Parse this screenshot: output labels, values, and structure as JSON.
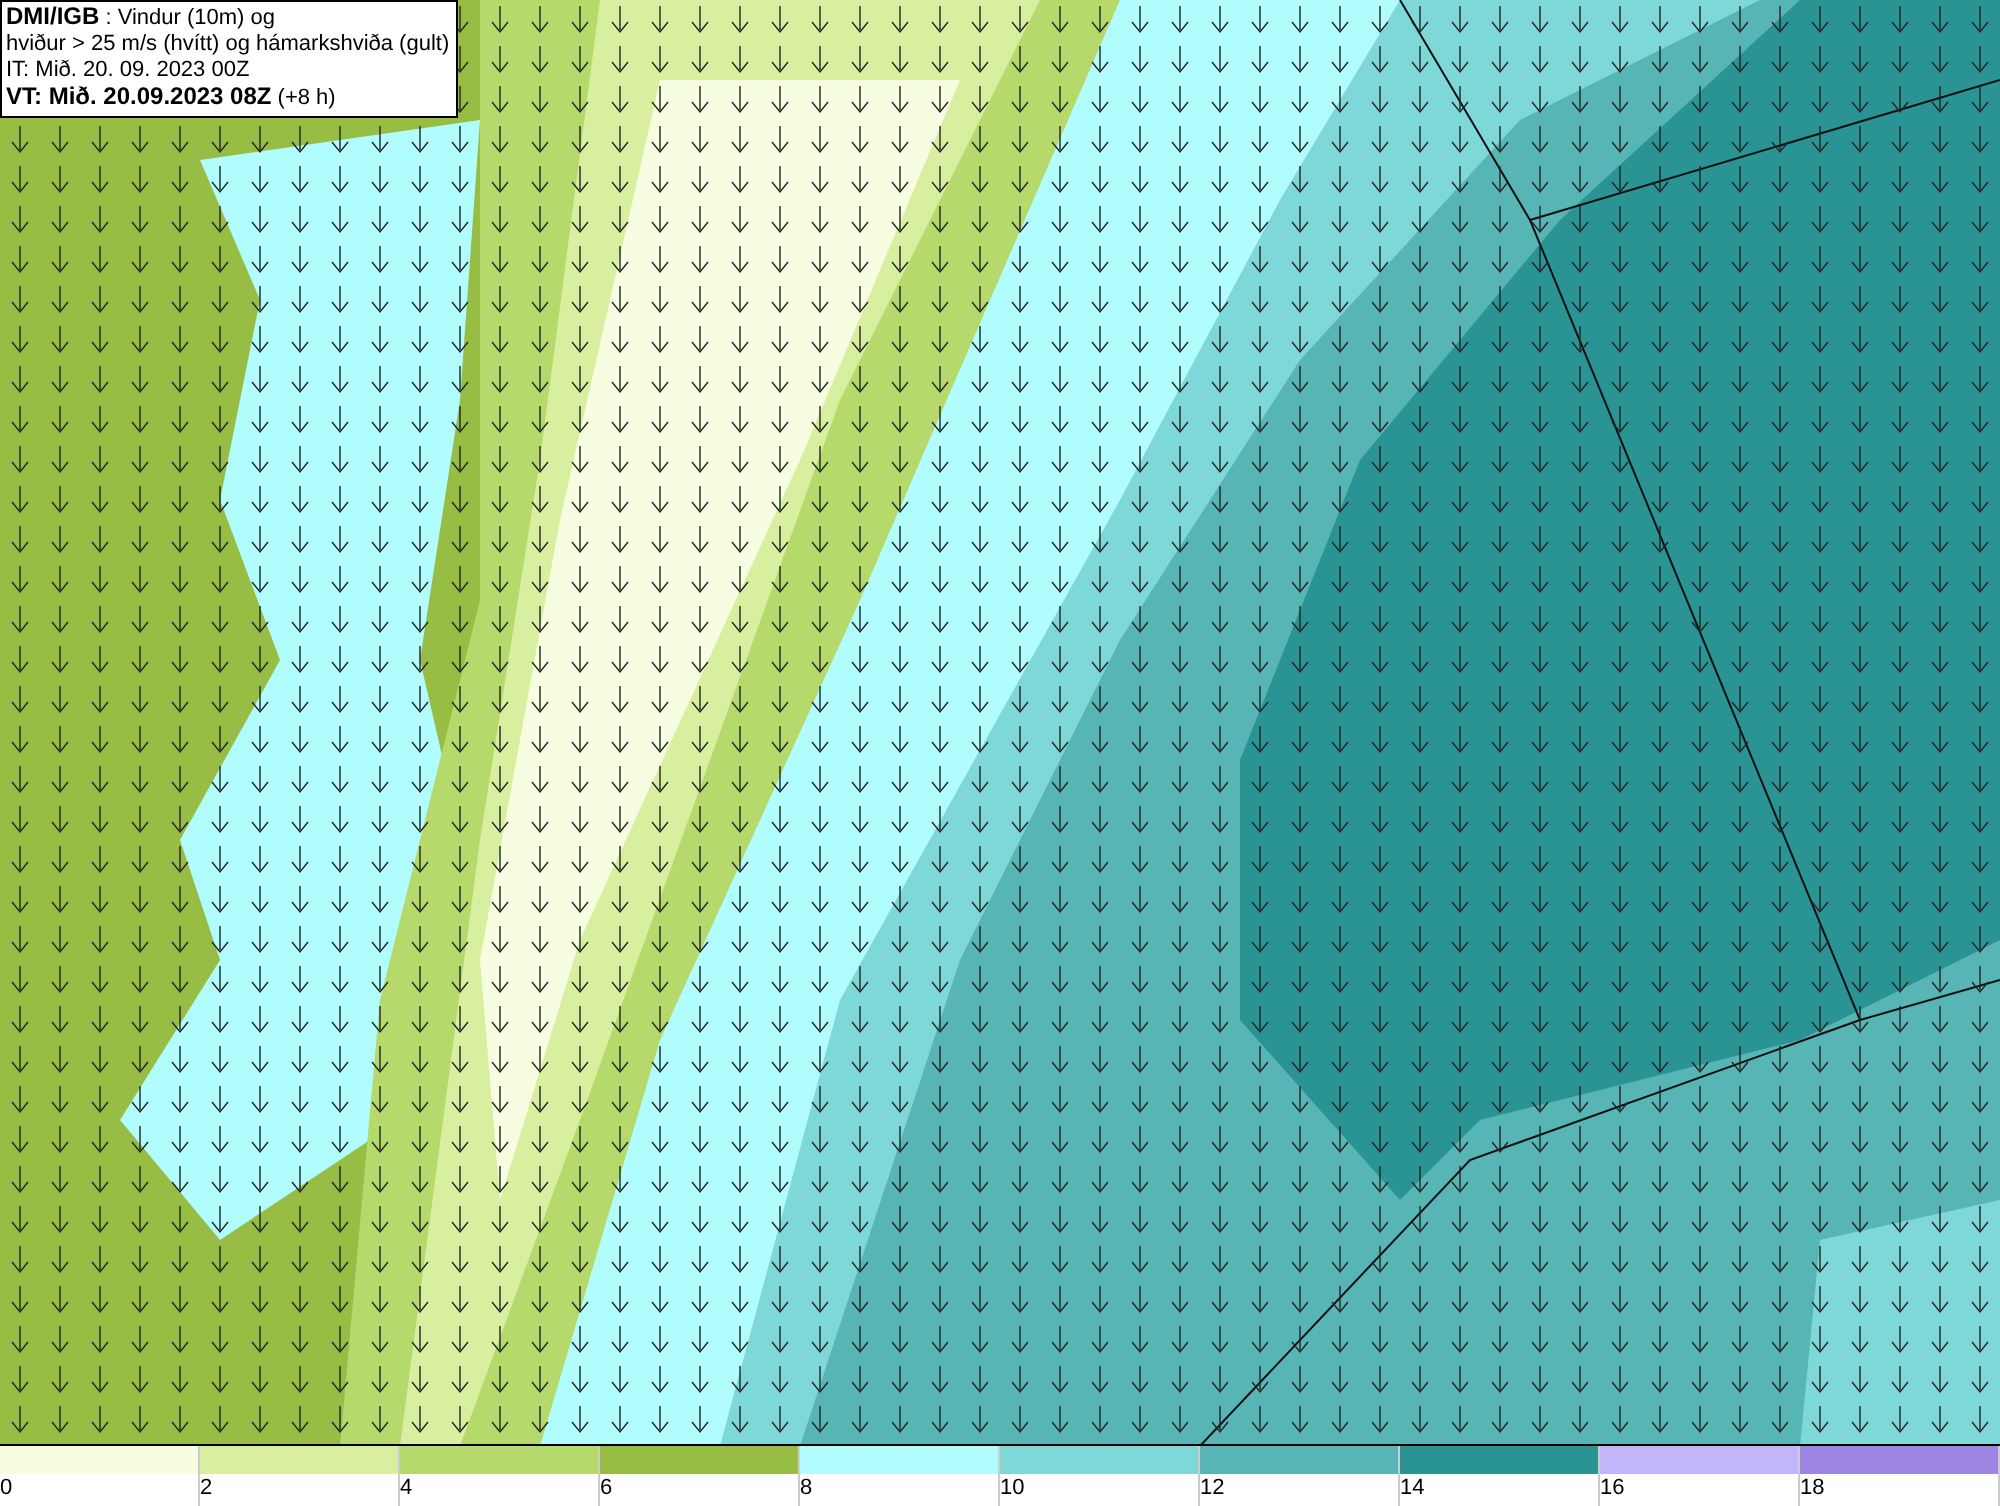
{
  "info_box": {
    "lines": [
      "**DMI/IGB** : Vindur (10m) og",
      "hviður > 25 m/s (hvítt) og hámarkshviða (gult)",
      "IT: Mið. 20. 09. 2023 00Z",
      "**VT: Mið. 20.09.2023 08Z** (+8 h)"
    ]
  },
  "legend": [
    {
      "label": "0",
      "color": "#f7fde0"
    },
    {
      "label": "2",
      "color": "#d9efa0"
    },
    {
      "label": "4",
      "color": "#b5d96a"
    },
    {
      "label": "6",
      "color": "#97bd45"
    },
    {
      "label": "8",
      "color": "#b1fcfc"
    },
    {
      "label": "10",
      "color": "#7fd8d8"
    },
    {
      "label": "12",
      "color": "#57b5b5"
    },
    {
      "label": "14",
      "color": "#2a9494"
    },
    {
      "label": "16",
      "color": "#c3b5f9"
    },
    {
      "label": "18",
      "color": "#9e85e3"
    }
  ]
}
